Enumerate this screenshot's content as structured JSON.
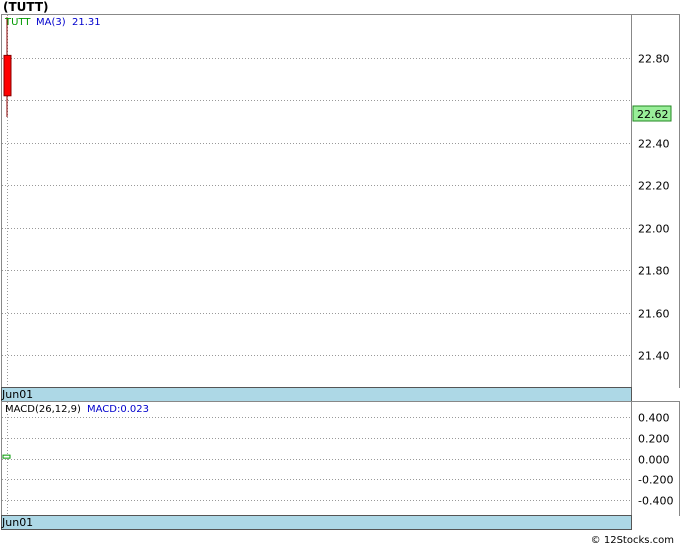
{
  "title": "(TUTT)",
  "footer": "© 12Stocks.com",
  "price_panel": {
    "legend": {
      "symbol": "TUTT",
      "ma_label": "MA(3)",
      "ma_value": "21.31"
    },
    "date_label": "Jun01",
    "current_price_label": "22.62",
    "colors": {
      "up": "#00aa00",
      "down": "#ff0000",
      "ma": "#0000cc",
      "price_badge": "#99ee99"
    }
  },
  "macd_panel": {
    "legend": {
      "name": "MACD(26,12,9)",
      "value_label": "MACD:0.023"
    },
    "date_label": "Jun01"
  },
  "chart_data": [
    {
      "type": "candlestick",
      "title": "(TUTT)",
      "ylim": [
        21.25,
        23.0
      ],
      "y_ticks": [
        21.4,
        21.6,
        21.8,
        22.0,
        22.2,
        22.4,
        22.6,
        22.8
      ],
      "y_tick_labels": [
        "21.40",
        "21.60",
        "21.80",
        "22.00",
        "22.20",
        "22.40",
        "",
        "22.80"
      ],
      "x_labels": [
        "Jun01"
      ],
      "candles": [
        {
          "date": "Jun01",
          "open": 22.81,
          "high": 22.99,
          "low": 22.52,
          "close": 22.62
        }
      ],
      "series": [
        {
          "name": "MA(3)",
          "last_value": 21.31
        }
      ],
      "grid": true
    },
    {
      "type": "bar",
      "title": "MACD(26,12,9)",
      "ylim": [
        -0.55,
        0.55
      ],
      "y_ticks": [
        0.4,
        0.2,
        0.0,
        -0.2,
        -0.4
      ],
      "y_tick_labels": [
        "0.400",
        "0.200",
        "0.000",
        "-0.200",
        "-0.400"
      ],
      "x_labels": [
        "Jun01"
      ],
      "values": [
        0.023
      ],
      "grid": true
    }
  ]
}
